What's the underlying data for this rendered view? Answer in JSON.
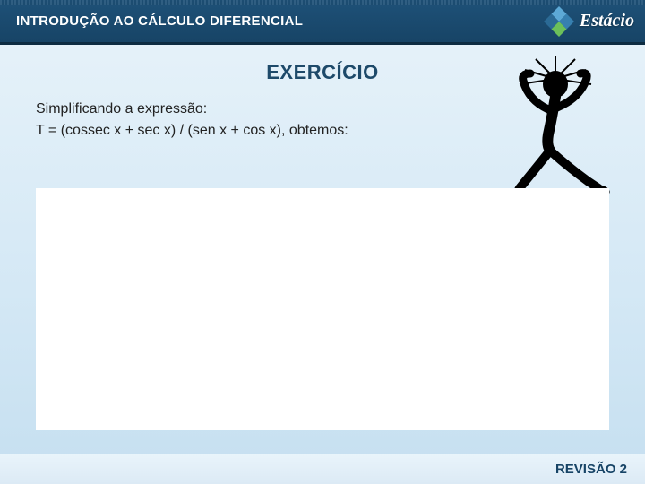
{
  "header": {
    "course_title": "INTRODUÇÃO AO CÁLCULO DIFERENCIAL",
    "brand": "Estácio"
  },
  "section": {
    "title": "EXERCÍCIO"
  },
  "content": {
    "line1": "Simplificando a expressão:",
    "line2": "T = (cossec x + sec x) / (sen x + cos x), obtemos:"
  },
  "footer": {
    "label": "REVISÃO 2"
  }
}
